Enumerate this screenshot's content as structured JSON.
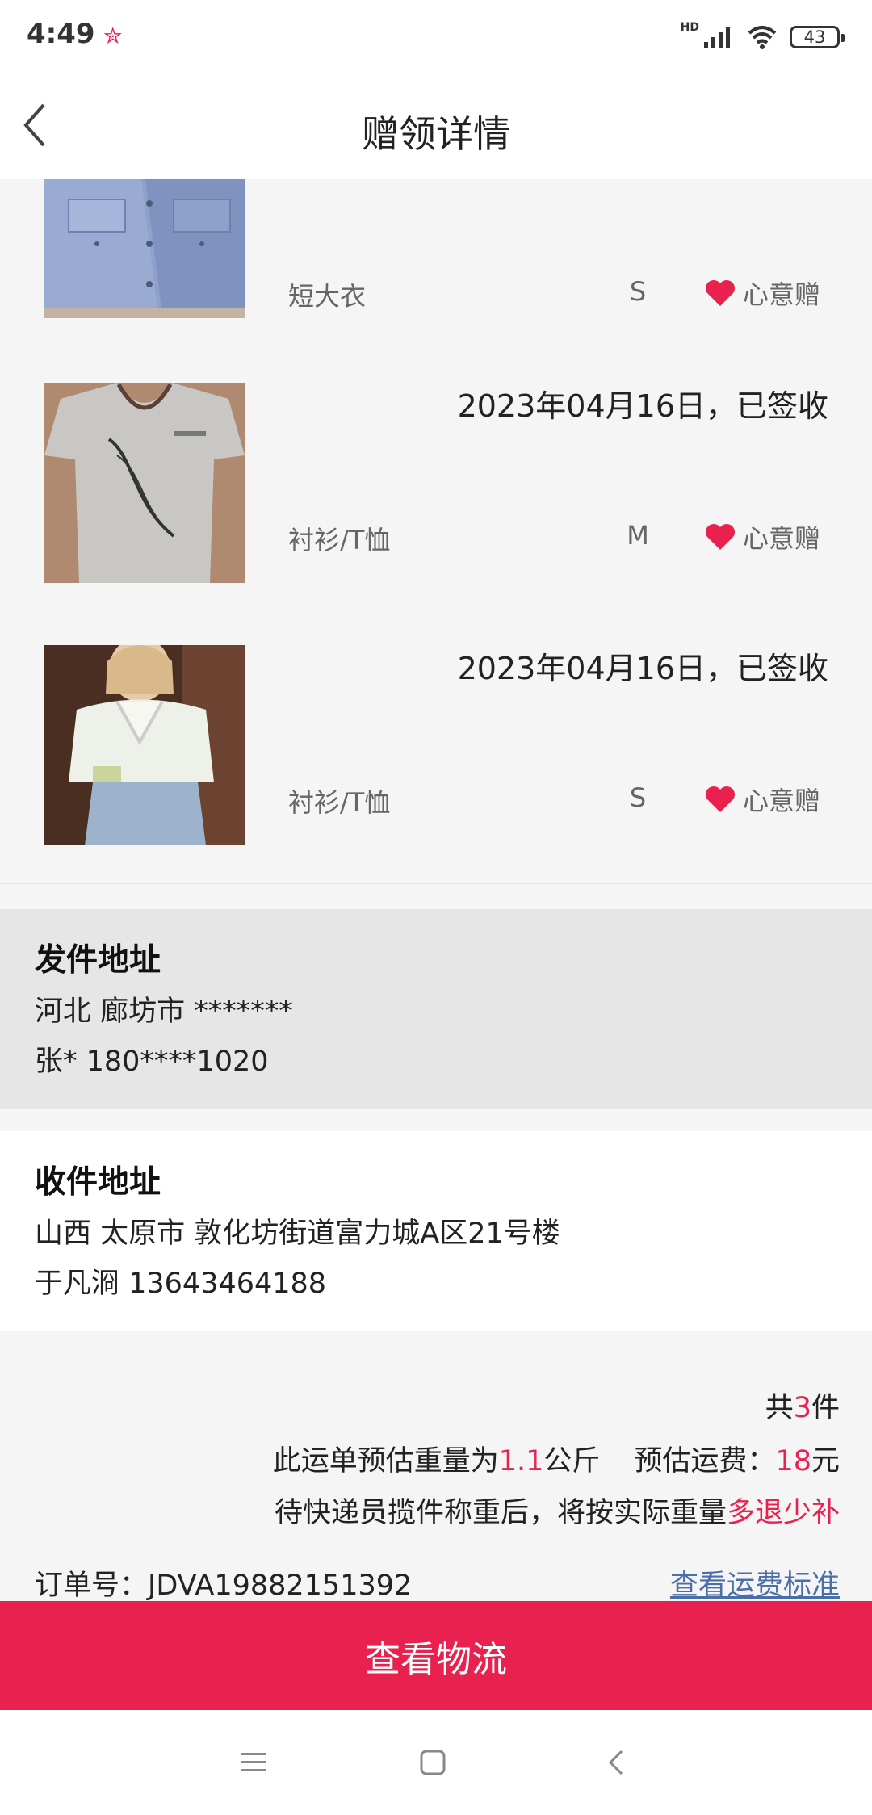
{
  "status_bar": {
    "time": "4:49",
    "hd": "HD",
    "battery": "43"
  },
  "header": {
    "title": "赠领详情"
  },
  "items": [
    {
      "date": "",
      "category": "短大衣",
      "size": "S",
      "gift_label": "心意赠"
    },
    {
      "date": "2023年04月16日，已签收",
      "category": "衬衫/T恤",
      "size": "M",
      "gift_label": "心意赠"
    },
    {
      "date": "2023年04月16日，已签收",
      "category": "衬衫/T恤",
      "size": "S",
      "gift_label": "心意赠"
    }
  ],
  "sender": {
    "title": "发件地址",
    "region": "河北 廊坊市 *******",
    "contact": "张* 180****1020"
  },
  "receiver": {
    "title": "收件地址",
    "address": "山西 太原市 敦化坊街道富力城A区21号楼",
    "contact": "于凡浻 13643464188"
  },
  "summary": {
    "count_prefix": "共",
    "count": "3",
    "count_suffix": "件",
    "weight_prefix": "此运单预估重量为",
    "weight": "1.1",
    "weight_suffix": "公斤",
    "fee_prefix": "预估运费：",
    "fee": "18",
    "fee_suffix": "元",
    "note_prefix": "待快递员揽件称重后，将按实际重量",
    "note_highlight": "多退少补",
    "order_label": "订单号：",
    "order_no": "JDVA19882151392",
    "fee_link": "查看运费标准"
  },
  "cta": {
    "label": "查看物流"
  },
  "colors": {
    "accent": "#e8214f",
    "link": "#4a6ea8"
  }
}
